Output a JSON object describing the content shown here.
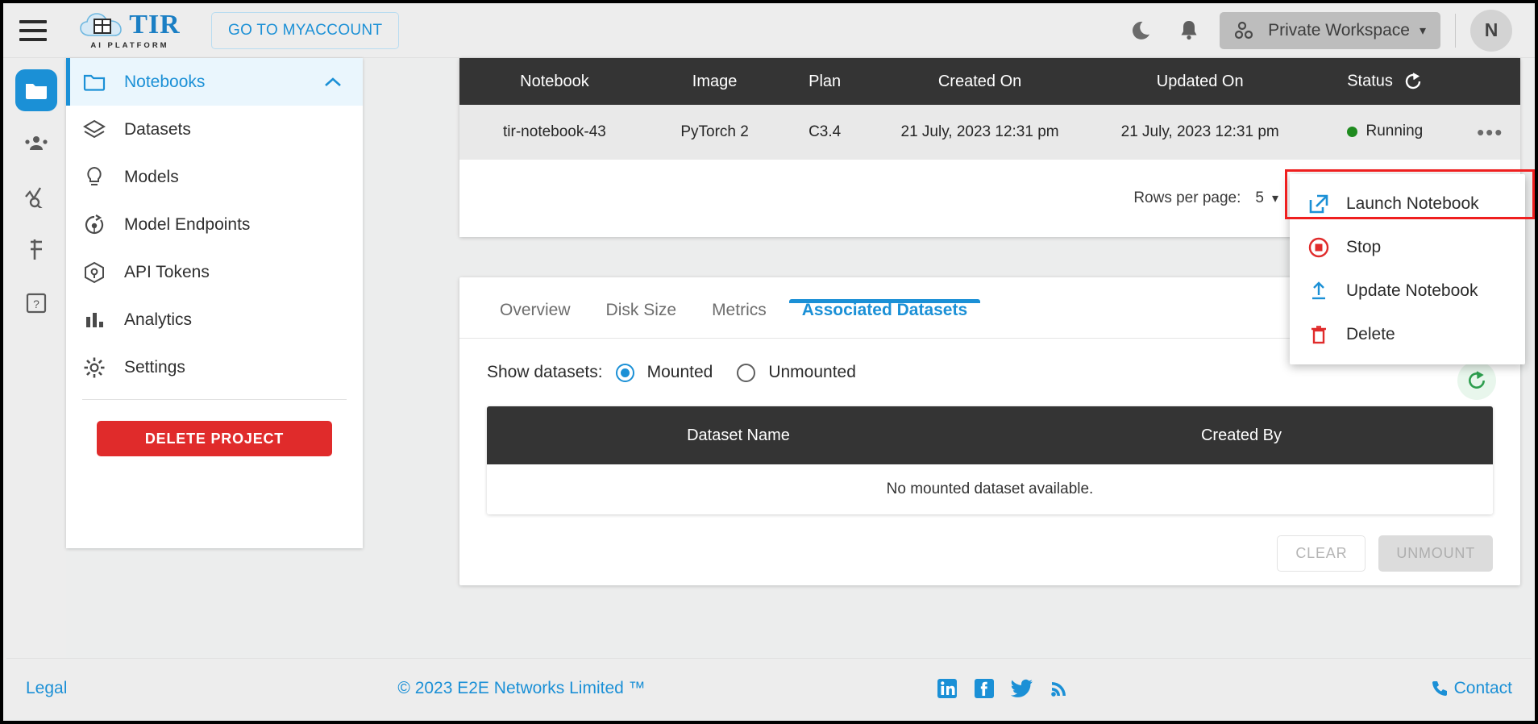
{
  "header": {
    "menu_icon": "hamburger-icon",
    "brand_name": "TIR",
    "brand_tagline": "AI PLATFORM",
    "myaccount_label": "GO TO MYACCOUNT",
    "dark_mode_icon": "moon-icon",
    "notification_icon": "bell-icon",
    "workspace_label": "Private Workspace",
    "workspace_caret": "▾",
    "avatar_initial": "N"
  },
  "rail": {
    "items": [
      {
        "name": "projects",
        "icon": "folder-icon",
        "active": true
      },
      {
        "name": "team",
        "icon": "people-icon",
        "active": false
      },
      {
        "name": "monitoring",
        "icon": "analytics-search-icon",
        "active": false
      },
      {
        "name": "billing",
        "icon": "rupee-icon",
        "active": false
      },
      {
        "name": "help",
        "icon": "question-box-icon",
        "active": false
      }
    ]
  },
  "sidebar": {
    "items": [
      {
        "label": "Notebooks",
        "icon": "folder-icon",
        "active": true,
        "chevron": "chevron-up-icon"
      },
      {
        "label": "Datasets",
        "icon": "layers-icon",
        "active": false
      },
      {
        "label": "Models",
        "icon": "bulb-icon",
        "active": false
      },
      {
        "label": "Model Endpoints",
        "icon": "endpoint-icon",
        "active": false
      },
      {
        "label": "API Tokens",
        "icon": "cube-icon",
        "active": false
      },
      {
        "label": "Analytics",
        "icon": "bar-chart-icon",
        "active": false
      },
      {
        "label": "Settings",
        "icon": "gear-icon",
        "active": false
      }
    ],
    "delete_project_label": "DELETE PROJECT"
  },
  "notebook_table": {
    "columns": [
      "Notebook",
      "Image",
      "Plan",
      "Created On",
      "Updated On",
      "Status"
    ],
    "status_refresh_icon": "refresh-icon",
    "rows": [
      {
        "notebook": "tir-notebook-43",
        "image": "PyTorch 2",
        "plan": "C3.4",
        "created_on": "21 July, 2023 12:31 pm",
        "updated_on": "21 July, 2023 12:31 pm",
        "status": "Running",
        "status_color": "#1f8b1f",
        "actions_icon": "kebab-menu-icon"
      }
    ],
    "pagination": {
      "rows_per_page_label": "Rows per page:",
      "rows_per_page_value": "5",
      "caret": "▾"
    }
  },
  "context_menu": {
    "highlight_color": "#ef1f1f",
    "items": [
      {
        "label": "Launch Notebook",
        "icon": "external-link-icon",
        "icon_color": "#1b90d6",
        "highlighted": true
      },
      {
        "label": "Stop",
        "icon": "stop-circle-icon",
        "icon_color": "#e02b2b",
        "highlighted": false
      },
      {
        "label": "Update Notebook",
        "icon": "upload-icon",
        "icon_color": "#1b90d6",
        "highlighted": false
      },
      {
        "label": "Delete",
        "icon": "trash-icon",
        "icon_color": "#e02b2b",
        "highlighted": false
      }
    ]
  },
  "detail_panel": {
    "tabs": [
      {
        "label": "Overview",
        "active": false
      },
      {
        "label": "Disk Size",
        "active": false
      },
      {
        "label": "Metrics",
        "active": false
      },
      {
        "label": "Associated Datasets",
        "active": true
      }
    ],
    "show_datasets_label": "Show datasets:",
    "radio_mounted": "Mounted",
    "radio_unmounted": "Unmounted",
    "refresh_icon": "refresh-icon",
    "dataset_table": {
      "columns": [
        "Dataset Name",
        "Created By"
      ],
      "empty_message": "No mounted dataset available."
    },
    "clear_label": "CLEAR",
    "unmount_label": "UNMOUNT"
  },
  "footer": {
    "legal": "Legal",
    "copyright": "© 2023 E2E Networks Limited ™",
    "social": [
      "linkedin-icon",
      "facebook-icon",
      "twitter-icon",
      "rss-icon"
    ],
    "contact": "Contact",
    "contact_icon": "phone-icon"
  },
  "colors": {
    "accent": "#1b90d6",
    "danger": "#e02b2b",
    "header_dark": "#343434",
    "success": "#1f8b1f"
  }
}
